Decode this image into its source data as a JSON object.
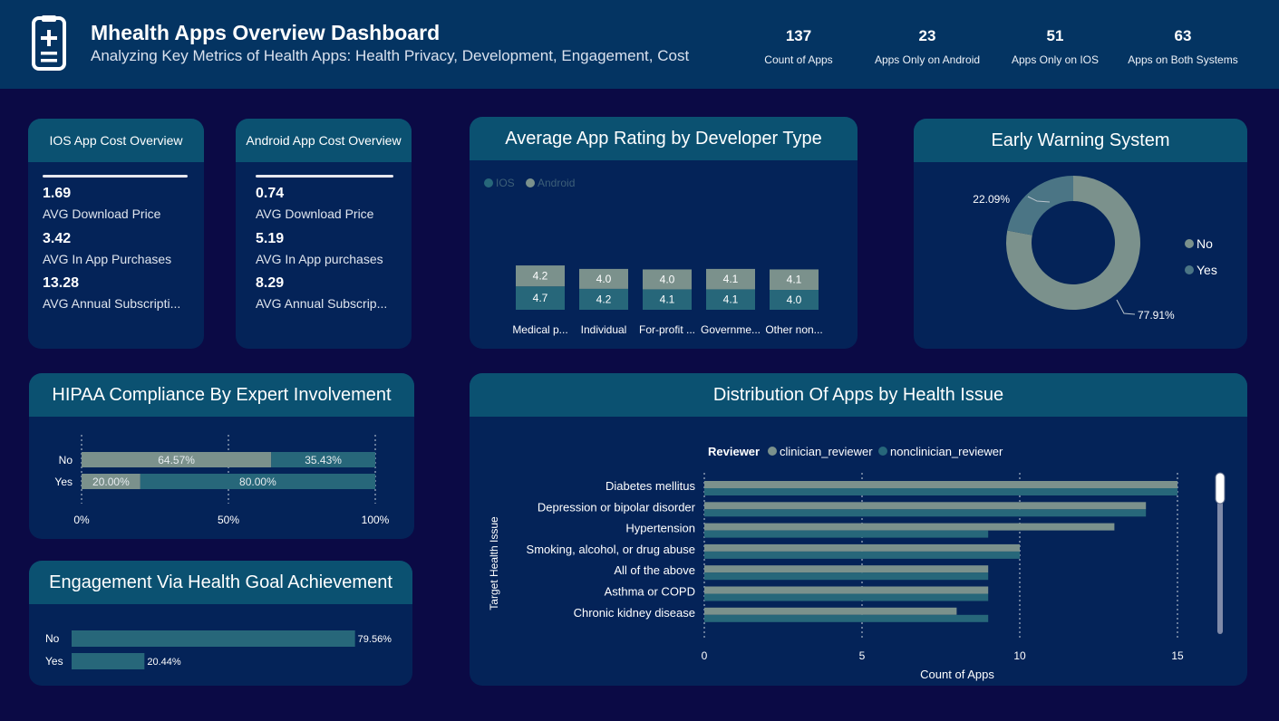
{
  "header": {
    "title": "Mhealth Apps Overview Dashboard",
    "subtitle": "Analyzing Key Metrics of Health Apps: Health Privacy, Development, Engagement, Cost",
    "kpis": [
      {
        "value": "137",
        "label": "Count of Apps"
      },
      {
        "value": "23",
        "label": "Apps Only on Android"
      },
      {
        "value": "51",
        "label": "Apps Only on IOS"
      },
      {
        "value": "63",
        "label": "Apps on Both Systems"
      }
    ]
  },
  "ios_cost": {
    "title": "IOS App Cost Overview",
    "items": [
      {
        "value": "1.69",
        "label": "AVG Download Price"
      },
      {
        "value": "3.42",
        "label": "AVG In App Purchases"
      },
      {
        "value": "13.28",
        "label": "AVG Annual Subscripti..."
      }
    ]
  },
  "android_cost": {
    "title": "Android App Cost Overview",
    "items": [
      {
        "value": "0.74",
        "label": "AVG Download Price"
      },
      {
        "value": "5.19",
        "label": "AVG In App purchases"
      },
      {
        "value": "8.29",
        "label": "AVG Annual Subscrip..."
      }
    ]
  },
  "colors": {
    "gray": "#7b918c",
    "teal": "#27677a",
    "yes_donut": "#4b7585"
  },
  "chart_data": [
    {
      "id": "rating",
      "type": "bar",
      "title": "Average App Rating by Developer Type",
      "stacked": true,
      "legend": [
        "IOS",
        "Android"
      ],
      "legend_position": "top-left",
      "categories": [
        "Medical p...",
        "Individual",
        "For-profit ...",
        "Governme...",
        "Other non..."
      ],
      "series": [
        {
          "name": "IOS",
          "values": [
            4.7,
            4.2,
            4.1,
            4.1,
            4.0
          ],
          "labels": [
            "4.7",
            "4.2",
            "4.1",
            "4.1",
            "4.0"
          ]
        },
        {
          "name": "Android",
          "values": [
            4.2,
            4.0,
            4.0,
            4.1,
            4.1
          ],
          "labels": [
            "4.2",
            "4.0",
            "4.0",
            "4.1",
            "4.1"
          ]
        }
      ]
    },
    {
      "id": "warning",
      "type": "pie",
      "donut": true,
      "title": "Early Warning System",
      "legend_position": "right",
      "slices": [
        {
          "name": "No",
          "value": 77.91,
          "label": "77.91%"
        },
        {
          "name": "Yes",
          "value": 22.09,
          "label": "22.09%"
        }
      ]
    },
    {
      "id": "hipaa",
      "type": "bar",
      "orientation": "horizontal",
      "stacked": true,
      "percent": true,
      "title": "HIPAA Compliance By Expert Involvement",
      "categories": [
        "No",
        "Yes"
      ],
      "series": [
        {
          "values": [
            64.57,
            20.0
          ],
          "labels": [
            "64.57%",
            "20.00%"
          ]
        },
        {
          "values": [
            35.43,
            80.0
          ],
          "labels": [
            "35.43%",
            "80.00%"
          ]
        }
      ],
      "xticks": [
        "0%",
        "50%",
        "100%"
      ],
      "xlim": [
        0,
        100
      ]
    },
    {
      "id": "engagement",
      "type": "bar",
      "orientation": "horizontal",
      "title": "Engagement Via Health Goal Achievement",
      "categories": [
        "No",
        "Yes"
      ],
      "values": [
        79.56,
        20.44
      ],
      "labels": [
        "79.56%",
        "20.44%"
      ]
    },
    {
      "id": "distribution",
      "type": "bar",
      "orientation": "horizontal",
      "title": "Distribution Of Apps by Health Issue",
      "legend_title": "Reviewer",
      "legend_position": "top",
      "xlabel": "Count of Apps",
      "ylabel": "Target Health Issue",
      "xlim": [
        0,
        15
      ],
      "xticks": [
        "0",
        "5",
        "10",
        "15"
      ],
      "categories": [
        "Diabetes mellitus",
        "Depression or bipolar disorder",
        "Hypertension",
        "Smoking, alcohol, or drug abuse",
        "All of the above",
        "Asthma or COPD",
        "Chronic kidney disease"
      ],
      "series": [
        {
          "name": "clinician_reviewer",
          "values": [
            15,
            14,
            13,
            10,
            9,
            9,
            8
          ]
        },
        {
          "name": "nonclinician_reviewer",
          "values": [
            15,
            14,
            9,
            10,
            9,
            9,
            9
          ]
        }
      ]
    }
  ]
}
